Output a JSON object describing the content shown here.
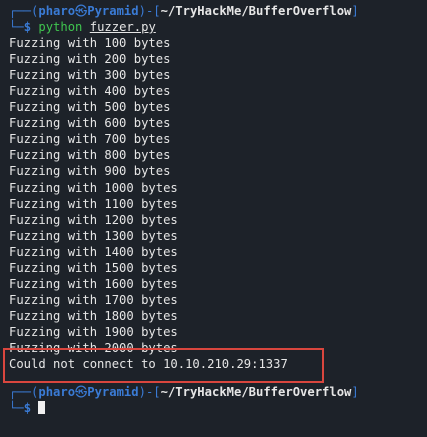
{
  "prompt1": {
    "corner_top": "┌──(",
    "user": "pharo",
    "skull": "㉿",
    "host": "Pyramid",
    "mid": ")-[",
    "path": "~/TryHackMe/BufferOverflow",
    "end": "]",
    "corner_bottom": "└─",
    "dollar": "$",
    "command": "python",
    "argument": "fuzzer.py"
  },
  "output": [
    "Fuzzing with 100 bytes",
    "Fuzzing with 200 bytes",
    "Fuzzing with 300 bytes",
    "Fuzzing with 400 bytes",
    "Fuzzing with 500 bytes",
    "Fuzzing with 600 bytes",
    "Fuzzing with 700 bytes",
    "Fuzzing with 800 bytes",
    "Fuzzing with 900 bytes",
    "Fuzzing with 1000 bytes",
    "Fuzzing with 1100 bytes",
    "Fuzzing with 1200 bytes",
    "Fuzzing with 1300 bytes",
    "Fuzzing with 1400 bytes",
    "Fuzzing with 1500 bytes",
    "Fuzzing with 1600 bytes",
    "Fuzzing with 1700 bytes",
    "Fuzzing with 1800 bytes",
    "Fuzzing with 1900 bytes",
    "Fuzzing with 2000 bytes",
    "Could not connect to 10.10.210.29:1337"
  ],
  "prompt2": {
    "corner_top": "┌──(",
    "user": "pharo",
    "skull": "㉿",
    "host": "Pyramid",
    "mid": ")-[",
    "path": "~/TryHackMe/BufferOverflow",
    "end": "]",
    "corner_bottom": "└─",
    "dollar": "$"
  },
  "colors": {
    "background": "#1d2229",
    "prompt_blue": "#3a7bd5",
    "command_green": "#3fc54f",
    "highlight_red": "#d9463e"
  }
}
